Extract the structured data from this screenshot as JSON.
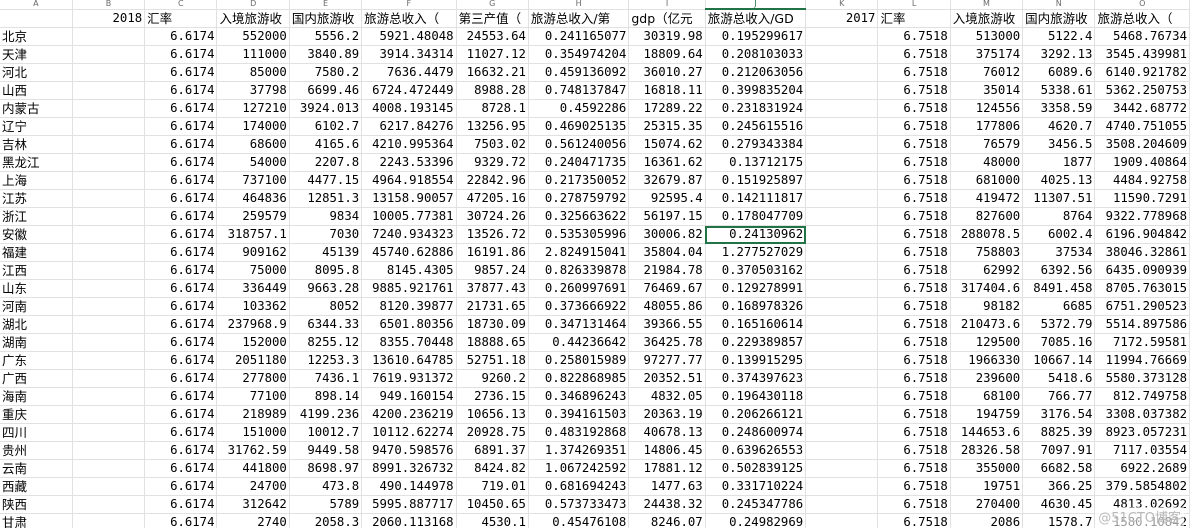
{
  "columns": [
    "A",
    "B",
    "C",
    "D",
    "E",
    "F",
    "G",
    "H",
    "I",
    "J",
    "K",
    "L",
    "M",
    "N",
    "O"
  ],
  "selected_column": "J",
  "header_row": [
    "",
    "2018",
    "汇率",
    "入境旅游收",
    "国内旅游收",
    "旅游总收入（",
    "第三产值（",
    "旅游总收入/第",
    "gdp（亿元",
    "旅游总收入/GD",
    "2017",
    "汇率",
    "入境旅游收",
    "国内旅游收",
    "旅游总收入（"
  ],
  "rows": [
    [
      "北京",
      "",
      "6.6174",
      "552000",
      "5556.2",
      "5921.48048",
      "24553.64",
      "0.241165077",
      "30319.98",
      "0.195299617",
      "",
      "6.7518",
      "513000",
      "5122.4",
      "5468.76734"
    ],
    [
      "天津",
      "",
      "6.6174",
      "111000",
      "3840.89",
      "3914.34314",
      "11027.12",
      "0.354974204",
      "18809.64",
      "0.208103033",
      "",
      "6.7518",
      "375174",
      "3292.13",
      "3545.439981"
    ],
    [
      "河北",
      "",
      "6.6174",
      "85000",
      "7580.2",
      "7636.4479",
      "16632.21",
      "0.459136092",
      "36010.27",
      "0.212063056",
      "",
      "6.7518",
      "76012",
      "6089.6",
      "6140.921782"
    ],
    [
      "山西",
      "",
      "6.6174",
      "37798",
      "6699.46",
      "6724.472449",
      "8988.28",
      "0.748137847",
      "16818.11",
      "0.399835204",
      "",
      "6.7518",
      "35014",
      "5338.61",
      "5362.250753"
    ],
    [
      "内蒙古",
      "",
      "6.6174",
      "127210",
      "3924.013",
      "4008.193145",
      "8728.1",
      "0.4592286",
      "17289.22",
      "0.231831924",
      "",
      "6.7518",
      "124556",
      "3358.59",
      "3442.68772"
    ],
    [
      "辽宁",
      "",
      "6.6174",
      "174000",
      "6102.7",
      "6217.84276",
      "13256.95",
      "0.469025135",
      "25315.35",
      "0.245615516",
      "",
      "6.7518",
      "177806",
      "4620.7",
      "4740.751055"
    ],
    [
      "吉林",
      "",
      "6.6174",
      "68600",
      "4165.6",
      "4210.995364",
      "7503.02",
      "0.561240056",
      "15074.62",
      "0.279343384",
      "",
      "6.7518",
      "76579",
      "3456.5",
      "3508.204609"
    ],
    [
      "黑龙江",
      "",
      "6.6174",
      "54000",
      "2207.8",
      "2243.53396",
      "9329.72",
      "0.240471735",
      "16361.62",
      "0.13712175",
      "",
      "6.7518",
      "48000",
      "1877",
      "1909.40864"
    ],
    [
      "上海",
      "",
      "6.6174",
      "737100",
      "4477.15",
      "4964.918554",
      "22842.96",
      "0.217350052",
      "32679.87",
      "0.151925897",
      "",
      "6.7518",
      "681000",
      "4025.13",
      "4484.92758"
    ],
    [
      "江苏",
      "",
      "6.6174",
      "464836",
      "12851.3",
      "13158.90057",
      "47205.16",
      "0.278759792",
      "92595.4",
      "0.142111817",
      "",
      "6.7518",
      "419472",
      "11307.51",
      "11590.7291"
    ],
    [
      "浙江",
      "",
      "6.6174",
      "259579",
      "9834",
      "10005.77381",
      "30724.26",
      "0.325663622",
      "56197.15",
      "0.178047709",
      "",
      "6.7518",
      "827600",
      "8764",
      "9322.778968"
    ],
    [
      "安徽",
      "",
      "6.6174",
      "318757.1",
      "7030",
      "7240.934323",
      "13526.72",
      "0.535305996",
      "30006.82",
      "0.24130962",
      "",
      "6.7518",
      "288078.5",
      "6002.4",
      "6196.904842"
    ],
    [
      "福建",
      "",
      "6.6174",
      "909162",
      "45139",
      "45740.62886",
      "16191.86",
      "2.824915041",
      "35804.04",
      "1.277527029",
      "",
      "6.7518",
      "758803",
      "37534",
      "38046.32861"
    ],
    [
      "江西",
      "",
      "6.6174",
      "75000",
      "8095.8",
      "8145.4305",
      "9857.24",
      "0.826339878",
      "21984.78",
      "0.370503162",
      "",
      "6.7518",
      "62992",
      "6392.56",
      "6435.090939"
    ],
    [
      "山东",
      "",
      "6.6174",
      "336449",
      "9663.28",
      "9885.921761",
      "37877.43",
      "0.260997691",
      "76469.67",
      "0.129278991",
      "",
      "6.7518",
      "317404.6",
      "8491.458",
      "8705.763015"
    ],
    [
      "河南",
      "",
      "6.6174",
      "103362",
      "8052",
      "8120.39877",
      "21731.65",
      "0.373666922",
      "48055.86",
      "0.168978326",
      "",
      "6.7518",
      "98182",
      "6685",
      "6751.290523"
    ],
    [
      "湖北",
      "",
      "6.6174",
      "237968.9",
      "6344.33",
      "6501.80356",
      "18730.09",
      "0.347131464",
      "39366.55",
      "0.165160614",
      "",
      "6.7518",
      "210473.6",
      "5372.79",
      "5514.897586"
    ],
    [
      "湖南",
      "",
      "6.6174",
      "152000",
      "8255.12",
      "8355.70448",
      "18888.65",
      "0.44236642",
      "36425.78",
      "0.229389857",
      "",
      "6.7518",
      "129500",
      "7085.16",
      "7172.59581"
    ],
    [
      "广东",
      "",
      "6.6174",
      "2051180",
      "12253.3",
      "13610.64785",
      "52751.18",
      "0.258015989",
      "97277.77",
      "0.139915295",
      "",
      "6.7518",
      "1966330",
      "10667.14",
      "11994.76669"
    ],
    [
      "广西",
      "",
      "6.6174",
      "277800",
      "7436.1",
      "7619.931372",
      "9260.2",
      "0.822868985",
      "20352.51",
      "0.374397623",
      "",
      "6.7518",
      "239600",
      "5418.6",
      "5580.373128"
    ],
    [
      "海南",
      "",
      "6.6174",
      "77100",
      "898.14",
      "949.160154",
      "2736.15",
      "0.346896243",
      "4832.05",
      "0.196430118",
      "",
      "6.7518",
      "68100",
      "766.77",
      "812.749758"
    ],
    [
      "重庆",
      "",
      "6.6174",
      "218989",
      "4199.236",
      "4200.236219",
      "10656.13",
      "0.394161503",
      "20363.19",
      "0.206266121",
      "",
      "6.7518",
      "194759",
      "3176.54",
      "3308.037382"
    ],
    [
      "四川",
      "",
      "6.6174",
      "151000",
      "10012.7",
      "10112.62274",
      "20928.75",
      "0.483192868",
      "40678.13",
      "0.248600974",
      "",
      "6.7518",
      "144653.6",
      "8825.39",
      "8923.057231"
    ],
    [
      "贵州",
      "",
      "6.6174",
      "31762.59",
      "9449.58",
      "9470.598576",
      "6891.37",
      "1.374269351",
      "14806.45",
      "0.639626553",
      "",
      "6.7518",
      "28326.58",
      "7097.91",
      "7117.03554"
    ],
    [
      "云南",
      "",
      "6.6174",
      "441800",
      "8698.97",
      "8991.326732",
      "8424.82",
      "1.067242592",
      "17881.12",
      "0.502839125",
      "",
      "6.7518",
      "355000",
      "6682.58",
      "6922.2689"
    ],
    [
      "西藏",
      "",
      "6.6174",
      "24700",
      "473.8",
      "490.144978",
      "719.01",
      "0.681694243",
      "1477.63",
      "0.331710224",
      "",
      "6.7518",
      "19751",
      "366.25",
      "379.5854802"
    ],
    [
      "陕西",
      "",
      "6.6174",
      "312642",
      "5789",
      "5995.887717",
      "10450.65",
      "0.573733473",
      "24438.32",
      "0.245347786",
      "",
      "6.7518",
      "270400",
      "4630.45",
      "4813.02692"
    ],
    [
      "甘肃",
      "",
      "6.6174",
      "2740",
      "2058.3",
      "2060.113168",
      "4530.1",
      "0.45476108",
      "8246.07",
      "0.24982969",
      "",
      "6.7518",
      "2086",
      "1578.7",
      "1580.10842"
    ]
  ],
  "active_cell": {
    "row": 11,
    "col": 9
  },
  "watermark": "@51CTO博客"
}
